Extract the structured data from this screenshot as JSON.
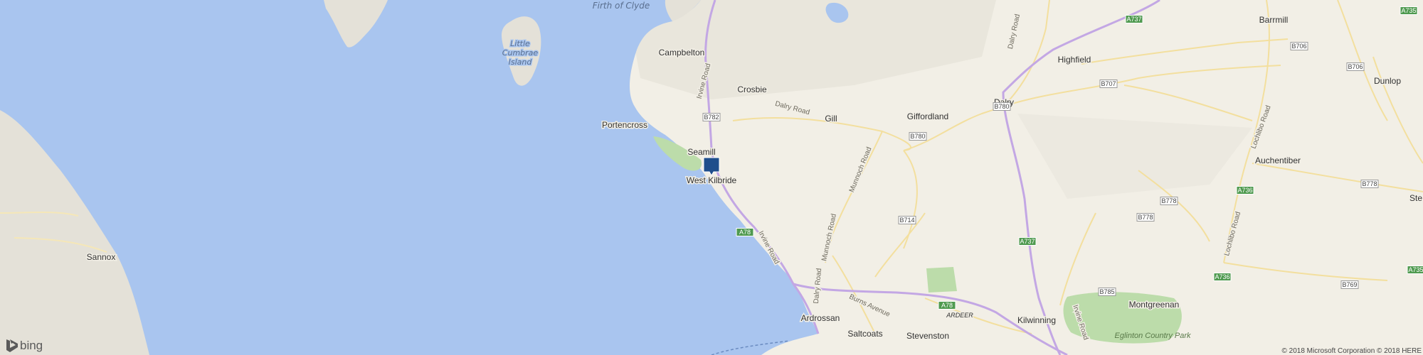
{
  "map": {
    "places": [
      {
        "name": "Campbelton",
        "size": "town"
      },
      {
        "name": "Crosbie",
        "size": "town"
      },
      {
        "name": "Portencross",
        "size": "town"
      },
      {
        "name": "Seamill",
        "size": "town"
      },
      {
        "name": "West Kilbride",
        "size": "town"
      },
      {
        "name": "Gill",
        "size": "town"
      },
      {
        "name": "Giffordland",
        "size": "town"
      },
      {
        "name": "Dalry",
        "size": "town"
      },
      {
        "name": "Highfield",
        "size": "town"
      },
      {
        "name": "Barrmill",
        "size": "town"
      },
      {
        "name": "Dunlop",
        "size": "town"
      },
      {
        "name": "Auchentiber",
        "size": "town"
      },
      {
        "name": "Ste",
        "size": "town"
      },
      {
        "name": "Sannox",
        "size": "town"
      },
      {
        "name": "Ardrossan",
        "size": "town"
      },
      {
        "name": "Saltcoats",
        "size": "town"
      },
      {
        "name": "Stevenston",
        "size": "town"
      },
      {
        "name": "Kilwinning",
        "size": "town"
      },
      {
        "name": "Montgreenan",
        "size": "town"
      },
      {
        "name": "ARDEER",
        "size": "district"
      }
    ],
    "water_labels": [
      "Firth of Clyde",
      "Little",
      "Cumbrae",
      "Island"
    ],
    "park_labels": [
      "Eglinton Country Park"
    ],
    "road_labels": [
      "Irvine Road",
      "Irvine Road",
      "Dalry Road",
      "Dalry Road",
      "Munnoch Road",
      "Munnoch Road",
      "Dalry Road",
      "Burns Avenue",
      "Lochlibo Road",
      "Lochlibo Road",
      "Irvine Road"
    ],
    "shields": [
      "A737",
      "B706",
      "B706",
      "B707",
      "B782",
      "B780",
      "B780",
      "B714",
      "A78",
      "A78",
      "A737",
      "B778",
      "B778",
      "A736",
      "B778",
      "A736",
      "B785",
      "B769",
      "A735",
      "A735"
    ],
    "pin": {
      "label": "West Kilbride",
      "color": "#1f4e8c"
    },
    "colors": {
      "water": "#a9c5ef",
      "land": "#f2efe6",
      "terrain": "#e6e3da",
      "motorway": "#c3a7e4",
      "park": "#bcdcaa",
      "pin": "#1f4e8c"
    }
  },
  "brand": {
    "logo": "bing",
    "icon": "bing-b-icon"
  },
  "copyright": "© 2018 Microsoft Corporation © 2018 HERE"
}
